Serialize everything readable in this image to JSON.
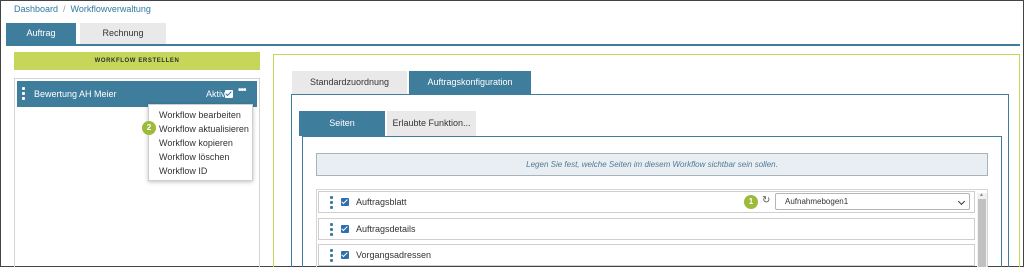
{
  "breadcrumb": {
    "items": [
      "Dashboard",
      "Workflowverwaltung"
    ],
    "separator": "/"
  },
  "main_tabs": [
    {
      "label": "Auftrag",
      "active": true
    },
    {
      "label": "Rechnung",
      "active": false
    }
  ],
  "left_panel": {
    "create_button": "WORKFLOW ERSTELLEN",
    "workflows": [
      {
        "name": "Bewertung AH Meier",
        "status": "Aktiv",
        "checked": true,
        "more": "•••"
      }
    ],
    "context_menu": {
      "items": [
        "Workflow bearbeiten",
        "Workflow aktualisieren",
        "Workflow kopieren",
        "Workflow löschen",
        "Workflow ID"
      ]
    }
  },
  "config": {
    "tabs": [
      {
        "label": "Standardzuordnung",
        "active": false
      },
      {
        "label": "Auftragskonfiguration",
        "active": true
      }
    ],
    "inner_tabs": [
      {
        "label": "Seiten",
        "active": true
      },
      {
        "label": "Erlaubte Funktion...",
        "active": false
      }
    ],
    "hint": "Legen Sie fest, welche Seiten im diesem Workflow sichtbar sein sollen.",
    "pages": [
      {
        "label": "Auftragsblatt",
        "checked": true,
        "template": "Aufnahmebogen1"
      },
      {
        "label": "Auftragsdetails",
        "checked": true
      },
      {
        "label": "Vorgangsadressen",
        "checked": true
      }
    ]
  },
  "annotations": {
    "badge_1": "1",
    "badge_2": "2"
  },
  "colors": {
    "primary": "#3f7d9c",
    "accent": "#c5d65a",
    "badge": "#9cbb3a",
    "tab_inactive": "#e9e9e9"
  },
  "icons": {
    "drag": "drag-handle-icon",
    "check": "checkbox-checked-icon",
    "more": "more-dots-icon",
    "refresh": "refresh-icon",
    "chevron": "chevron-down-icon"
  }
}
